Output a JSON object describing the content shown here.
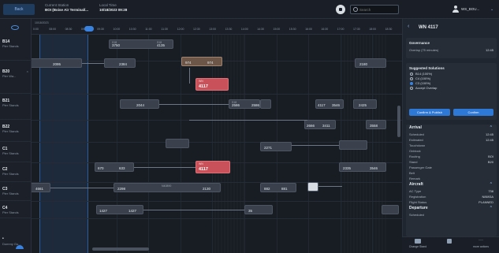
{
  "header": {
    "back_label": "Back",
    "station_label": "Current Station",
    "station_value": "BOI (Boise Air Terminal/...",
    "time_label": "Local Time",
    "time_value": "10/18/2023 09:28",
    "search_placeholder": "Search",
    "user_name": "WS_BOU..."
  },
  "resources": [
    {
      "name": "B14",
      "sub": "Pier Stands"
    },
    {
      "name": "B20",
      "sub": "Pier Wa..."
    },
    {
      "name": "B21",
      "sub": "Pier Stands"
    },
    {
      "name": "B22",
      "sub": "Pier Stands"
    },
    {
      "name": "C1",
      "sub": "Pier Stands"
    },
    {
      "name": "C2",
      "sub": "Pier Stands"
    },
    {
      "name": "C3",
      "sub": "Pier Stands"
    },
    {
      "name": "C4",
      "sub": "Pier Stands"
    }
  ],
  "dummy_row": "Dummy Gu...",
  "timeline": {
    "date": "10/18/2023",
    "ticks": [
      "0:00",
      "08:00",
      "08:30",
      "09:00",
      "09:30",
      "10:00",
      "10:30",
      "11:00",
      "11:30",
      "12:00",
      "12:30",
      "13:00",
      "13:30",
      "14:00",
      "14:30",
      "15:00",
      "15:30",
      "16:00",
      "16:30",
      "17:00",
      "17:30",
      "18:00",
      "18:30"
    ]
  },
  "bars": [
    {
      "n": "3750",
      "t": "S18",
      "n2": "4135",
      "t2": "S18"
    },
    {
      "n": "2095"
    },
    {
      "n": "2384"
    },
    {
      "n": "974",
      "n2": "974"
    },
    {
      "n": "2180"
    },
    {
      "n": "4117",
      "t": "WN",
      "kind": "red"
    },
    {
      "n": "2044"
    },
    {
      "n": "2586",
      "t": "S18"
    },
    {
      "n": "2586"
    },
    {
      "n": "4117",
      "t": "WN",
      "n2": "3546"
    },
    {
      "n": "2425"
    },
    {
      "n": "2666",
      "t": "WN",
      "n2": "3411"
    },
    {
      "n": "3558"
    },
    {
      "n": "2271"
    },
    {
      "n": "670",
      "n2": "633"
    },
    {
      "n": "4117",
      "t": "WN",
      "kind": "red"
    },
    {
      "n": "2335",
      "n2": "3546"
    },
    {
      "n": "4661"
    },
    {
      "n": "2298",
      "n2": "2130",
      "t": "N40890"
    },
    {
      "n": "882",
      "n2": "881"
    },
    {
      "n": "1427",
      "n2": "1427"
    },
    {
      "n": "35"
    }
  ],
  "panel": {
    "title": "WN 4117",
    "overview": {
      "heading": "Governance",
      "row_label": "Overlap (75 minutes)",
      "row_value": "12:45"
    },
    "solutions": {
      "heading": "Suggested Solutions",
      "options": [
        "B14 (100%)",
        "C4 (100%)",
        "C3 (100%)",
        "Accept Overlap"
      ],
      "selected_index": 2,
      "publish_label": "Confirm & Publish",
      "confirm_label": "Confirm"
    },
    "arrival": {
      "heading": "Arrival",
      "rows": [
        {
          "k": "Scheduled",
          "v": "12:45"
        },
        {
          "k": "Estimated",
          "v": "12:45"
        },
        {
          "k": "Touchdown",
          "v": ""
        },
        {
          "k": "Onblock",
          "v": ""
        },
        {
          "k": "Routing",
          "v": "BOI"
        },
        {
          "k": "Stand",
          "v": "B20"
        },
        {
          "k": "Passenger Gate",
          "v": ""
        },
        {
          "k": "Belt",
          "v": ""
        },
        {
          "k": "Remark",
          "v": ""
        }
      ]
    },
    "aircraft": {
      "heading": "Aircraft",
      "rows": [
        {
          "k": "AC Type",
          "v": "738"
        },
        {
          "k": "Registration",
          "v": "N8693A"
        },
        {
          "k": "Flight Status",
          "v": "PLANNED"
        }
      ]
    },
    "departure": {
      "heading": "Departure",
      "rows": [
        {
          "k": "Scheduled",
          "v": ""
        }
      ]
    },
    "footer": [
      "Change Stand",
      "",
      "more actions"
    ]
  },
  "colors": {
    "accent": "#3a82e0",
    "conflict": "#c9525a",
    "background": "#181c23"
  }
}
